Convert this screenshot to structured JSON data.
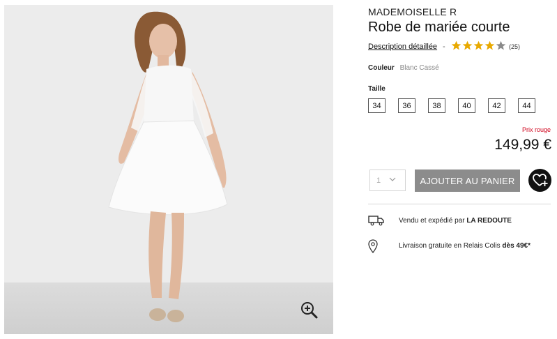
{
  "product": {
    "brand": "MADEMOISELLE R",
    "title": "Robe de mariée courte",
    "description_link": "Description détaillée",
    "rating_separator": "-",
    "rating": {
      "value": 4,
      "max": 5,
      "count_label": "(25)"
    },
    "color": {
      "label": "Couleur",
      "value": "Blanc Cassé"
    },
    "sizes": {
      "label": "Taille",
      "options": [
        "34",
        "36",
        "38",
        "40",
        "42",
        "44"
      ]
    },
    "price": {
      "label": "Prix rouge",
      "value": "149,99 €"
    }
  },
  "purchase": {
    "quantity": "1",
    "add_to_cart_label": "AJOUTER AU PANIER"
  },
  "delivery": {
    "seller_prefix": "Vendu et expédié par ",
    "seller_name": "LA REDOUTE",
    "relay_prefix": "Livraison gratuite en Relais Colis ",
    "relay_bold": "dès 49€*"
  },
  "icons": {
    "zoom": "zoom-in-icon",
    "star": "star-icon",
    "chevron": "chevron-down-icon",
    "wishlist": "heart-plus-icon",
    "truck": "truck-icon",
    "pin": "location-pin-icon"
  },
  "colors": {
    "star_filled": "#e8a900",
    "star_empty": "#8a8a8a",
    "button_gray": "#8c8c8c",
    "price_red": "#d0021b"
  }
}
